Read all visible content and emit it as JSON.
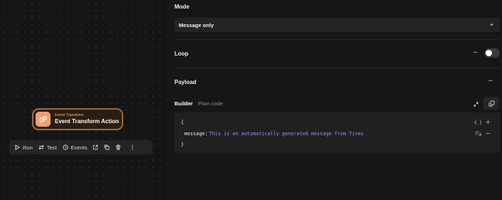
{
  "canvas": {
    "node": {
      "type_label": "Event Transform",
      "name": "Event Transform Action",
      "accent_color": "#f0a070"
    },
    "toolbar": {
      "run_label": "Run",
      "test_label": "Test",
      "events_label": "Events"
    }
  },
  "panel": {
    "mode": {
      "label": "Mode",
      "selected": "Message only"
    },
    "loop": {
      "label": "Loop",
      "enabled": false
    },
    "payload": {
      "label": "Payload",
      "tabs": [
        "Builder",
        "Plain code"
      ],
      "active_tab": "Builder",
      "code": {
        "open_brace": "{",
        "key": "message",
        "separator": ":",
        "value": "This is an automatically generated message from Tines",
        "close_brace": "}"
      }
    }
  }
}
